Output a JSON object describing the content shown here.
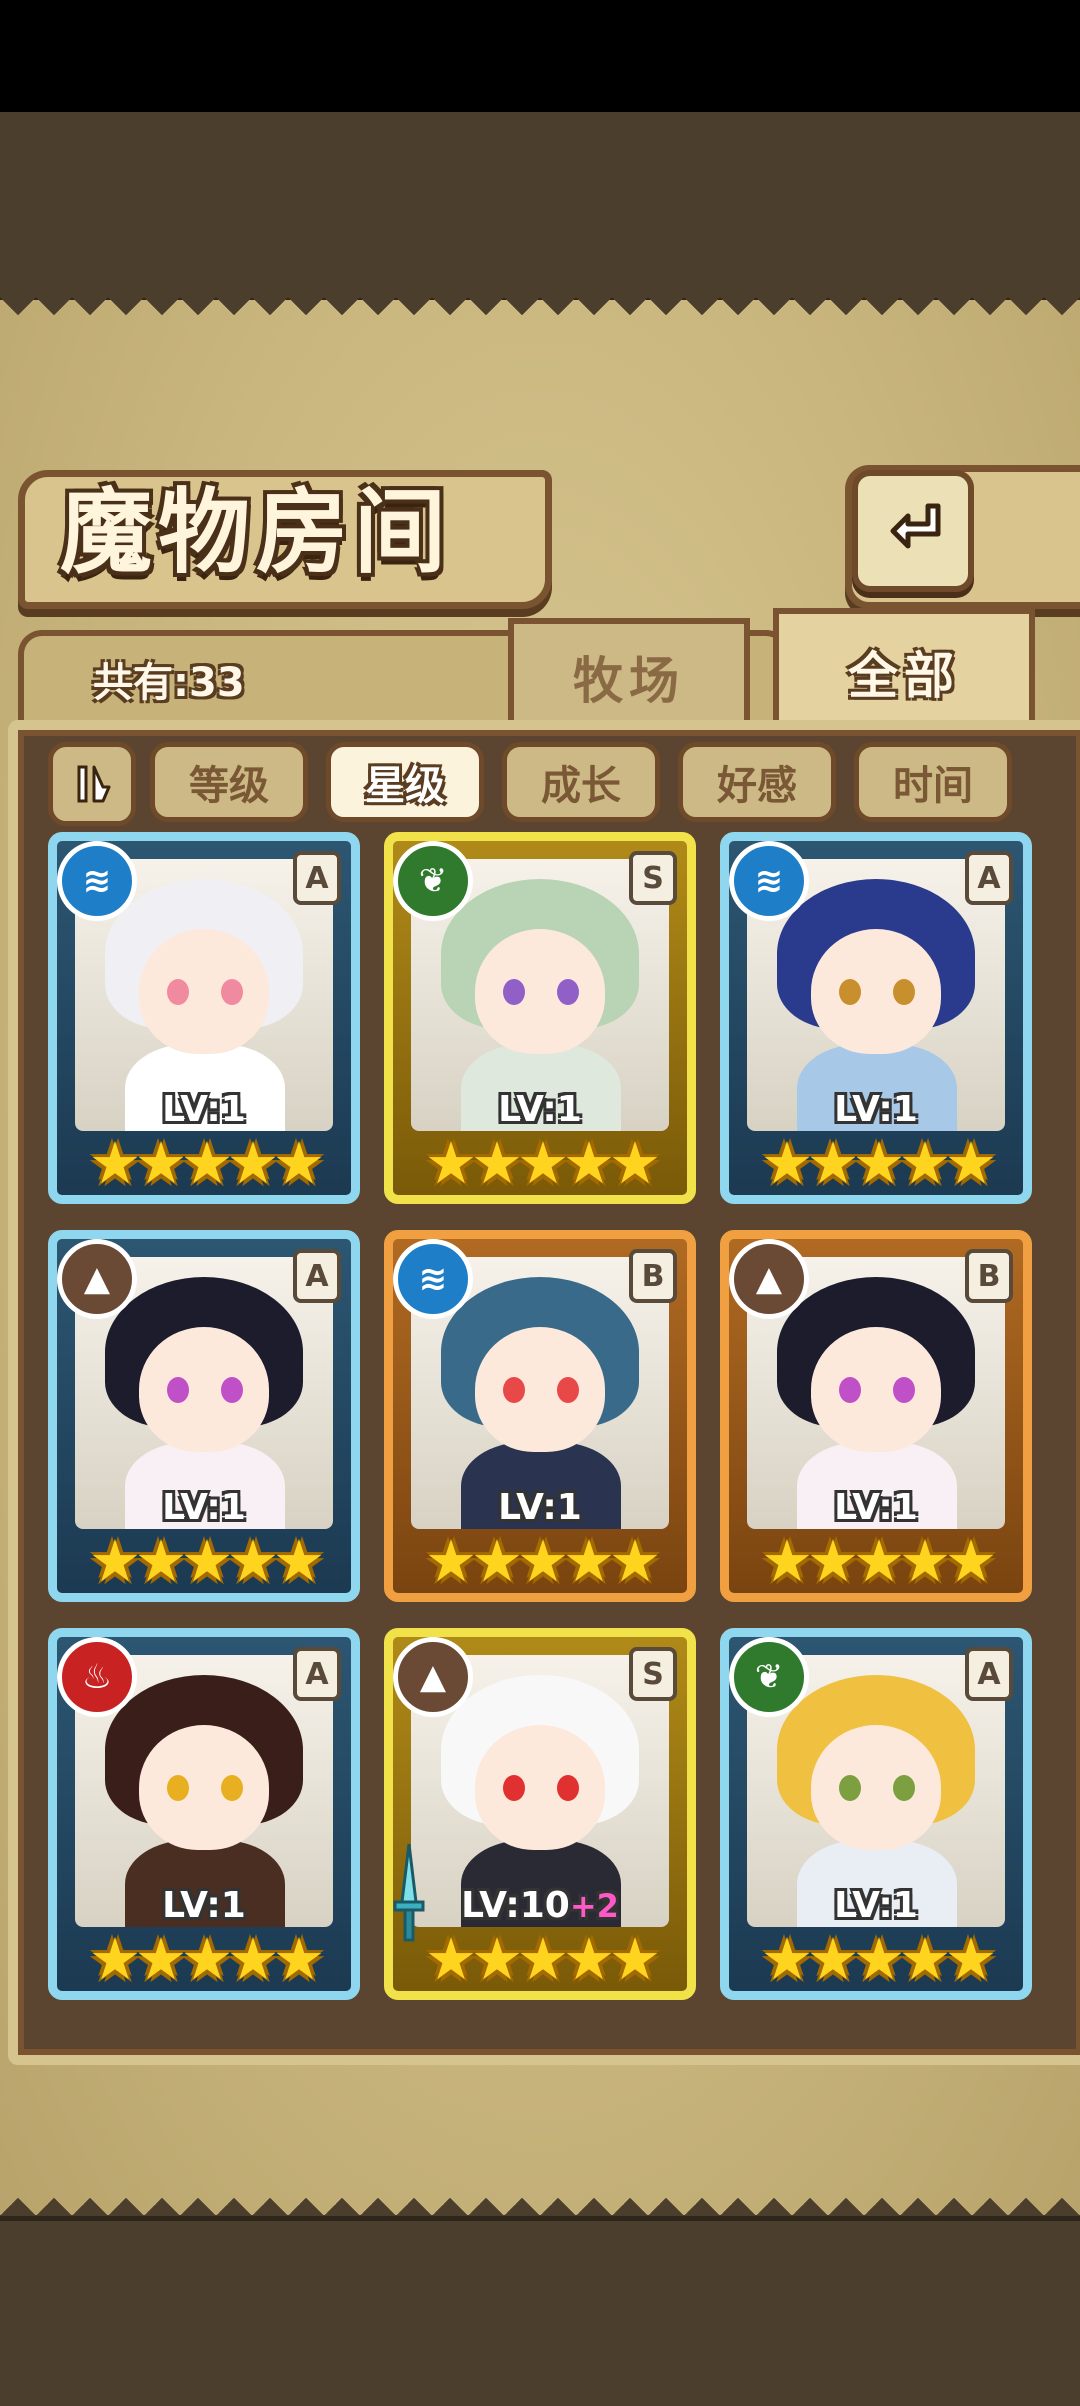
{
  "title": "魔物房间",
  "count_label": "共有:33",
  "tabs": [
    {
      "label": "牧场",
      "active": false
    },
    {
      "label": "全部",
      "active": true
    }
  ],
  "sort_buttons": [
    {
      "label": "等级",
      "active": false
    },
    {
      "label": "星级",
      "active": true
    },
    {
      "label": "成长",
      "active": false
    },
    {
      "label": "好感",
      "active": false
    },
    {
      "label": "时间",
      "active": false
    }
  ],
  "icons": {
    "back": "return-arrow-icon",
    "sort_toggle": "sort-order-toggle-icon",
    "star": "star-icon"
  },
  "elements": {
    "water": "water-element-icon",
    "leaf": "leaf-element-icon",
    "earth": "earth-element-icon",
    "fire": "fire-element-icon"
  },
  "monsters": [
    {
      "element": "water",
      "rank": "A",
      "level": "LV:1",
      "bonus": "",
      "stars": 5,
      "frame": "blue",
      "hair": "#f0f0f4",
      "eye": "#f08aa0",
      "outfit": "#ffffff"
    },
    {
      "element": "leaf",
      "rank": "S",
      "level": "LV:1",
      "bonus": "",
      "stars": 5,
      "frame": "gold",
      "hair": "#b8d4b4",
      "eye": "#9060c8",
      "outfit": "#dfe8dc"
    },
    {
      "element": "water",
      "rank": "A",
      "level": "LV:1",
      "bonus": "",
      "stars": 5,
      "frame": "blue",
      "hair": "#2a3a8c",
      "eye": "#c8902c",
      "outfit": "#a8c8e8"
    },
    {
      "element": "earth",
      "rank": "A",
      "level": "LV:1",
      "bonus": "",
      "stars": 5,
      "frame": "blue",
      "hair": "#1c1c2c",
      "eye": "#c050c8",
      "outfit": "#f8f0f4"
    },
    {
      "element": "water",
      "rank": "B",
      "level": "LV:1",
      "bonus": "",
      "stars": 5,
      "frame": "bronze",
      "hair": "#3a6a8a",
      "eye": "#e84848",
      "outfit": "#2a3450"
    },
    {
      "element": "earth",
      "rank": "B",
      "level": "LV:1",
      "bonus": "",
      "stars": 5,
      "frame": "bronze",
      "hair": "#1c1c2c",
      "eye": "#c050c8",
      "outfit": "#f8f0f4"
    },
    {
      "element": "fire",
      "rank": "A",
      "level": "LV:1",
      "bonus": "",
      "stars": 5,
      "frame": "blue",
      "hair": "#3a1e1a",
      "eye": "#e8b020",
      "outfit": "#4a2e22"
    },
    {
      "element": "earth",
      "rank": "S",
      "level": "LV:10",
      "bonus": "+2",
      "stars": 5,
      "frame": "gold",
      "hair": "#f8f8f8",
      "eye": "#e03030",
      "outfit": "#2a2a34"
    },
    {
      "element": "leaf",
      "rank": "A",
      "level": "LV:1",
      "bonus": "",
      "stars": 5,
      "frame": "blue",
      "hair": "#f0c040",
      "eye": "#7ca040",
      "outfit": "#e8eef4"
    }
  ]
}
